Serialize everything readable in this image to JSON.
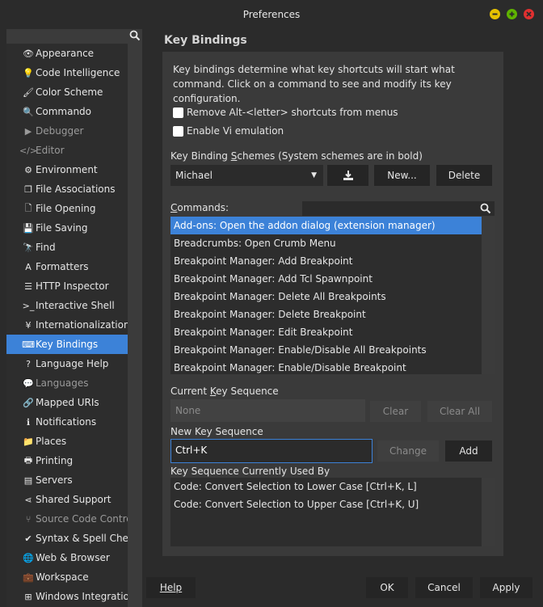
{
  "window": {
    "title": "Preferences"
  },
  "sidebar": {
    "items": [
      {
        "label": "Appearance",
        "icon": "eye-icon",
        "glyph": "👁",
        "dim": false
      },
      {
        "label": "Code Intelligence",
        "icon": "bulb-icon",
        "glyph": "💡",
        "dim": false
      },
      {
        "label": "Color Scheme",
        "icon": "brush-icon",
        "glyph": "🖌",
        "dim": false
      },
      {
        "label": "Commando",
        "icon": "search-icon",
        "glyph": "🔍",
        "dim": false
      },
      {
        "label": "Debugger",
        "icon": "play-icon",
        "glyph": "▶",
        "dim": true
      },
      {
        "label": "Editor",
        "icon": "code-icon",
        "glyph": "</>",
        "dim": true
      },
      {
        "label": "Environment",
        "icon": "gear-icon",
        "glyph": "⚙",
        "dim": false
      },
      {
        "label": "File Associations",
        "icon": "files-icon",
        "glyph": "❐",
        "dim": false
      },
      {
        "label": "File Opening",
        "icon": "file-icon",
        "glyph": "🗋",
        "dim": false
      },
      {
        "label": "File Saving",
        "icon": "floppy-icon",
        "glyph": "💾",
        "dim": false
      },
      {
        "label": "Find",
        "icon": "binoculars-icon",
        "glyph": "🔭",
        "dim": false
      },
      {
        "label": "Formatters",
        "icon": "font-icon",
        "glyph": "A",
        "dim": false
      },
      {
        "label": "HTTP Inspector",
        "icon": "list-icon",
        "glyph": "☰",
        "dim": false
      },
      {
        "label": "Interactive Shell",
        "icon": "terminal-icon",
        "glyph": ">_",
        "dim": false
      },
      {
        "label": "Internationalization",
        "icon": "yen-icon",
        "glyph": "¥",
        "dim": false
      },
      {
        "label": "Key Bindings",
        "icon": "keyboard-icon",
        "glyph": "⌨",
        "dim": false
      },
      {
        "label": "Language Help",
        "icon": "help-icon",
        "glyph": "?",
        "dim": false
      },
      {
        "label": "Languages",
        "icon": "speech-icon",
        "glyph": "💬",
        "dim": true
      },
      {
        "label": "Mapped URIs",
        "icon": "link-icon",
        "glyph": "🔗",
        "dim": false
      },
      {
        "label": "Notifications",
        "icon": "info-icon",
        "glyph": "ℹ",
        "dim": false
      },
      {
        "label": "Places",
        "icon": "folder-icon",
        "glyph": "📁",
        "dim": false
      },
      {
        "label": "Printing",
        "icon": "printer-icon",
        "glyph": "🖶",
        "dim": false
      },
      {
        "label": "Servers",
        "icon": "server-icon",
        "glyph": "▤",
        "dim": false
      },
      {
        "label": "Shared Support",
        "icon": "share-icon",
        "glyph": "⋖",
        "dim": false
      },
      {
        "label": "Source Code Control",
        "icon": "branch-icon",
        "glyph": "⑂",
        "dim": true
      },
      {
        "label": "Syntax & Spell Che...",
        "icon": "check-icon",
        "glyph": "✔",
        "dim": false
      },
      {
        "label": "Web & Browser",
        "icon": "globe-icon",
        "glyph": "🌐",
        "dim": false
      },
      {
        "label": "Workspace",
        "icon": "briefcase-icon",
        "glyph": "💼",
        "dim": false
      },
      {
        "label": "Windows Integration",
        "icon": "windows-icon",
        "glyph": "⊞",
        "dim": false
      }
    ],
    "selected": "Key Bindings"
  },
  "main": {
    "title": "Key Bindings",
    "description": "Key bindings determine what key shortcuts will start what command. Click on a command to see and modify its key configuration.",
    "remove_alt": "Remove Alt-<letter> shortcuts from menus",
    "vi_emulation": "Enable Vi emulation",
    "schemes_label_pre": "Key Binding ",
    "schemes_label_u": "S",
    "schemes_label_post": "chemes (System schemes are in bold)",
    "scheme_value": "Michael",
    "btn_new": "New...",
    "btn_delete": "Delete",
    "commands_label_u": "C",
    "commands_label_post": "ommands:",
    "commands": [
      "Add-ons: Open the addon dialog (extension manager)",
      "Breadcrumbs: Open Crumb Menu",
      "Breakpoint Manager: Add Breakpoint",
      "Breakpoint Manager: Add Tcl Spawnpoint",
      "Breakpoint Manager: Delete All Breakpoints",
      "Breakpoint Manager: Delete Breakpoint",
      "Breakpoint Manager: Edit Breakpoint",
      "Breakpoint Manager: Enable/Disable All Breakpoints",
      "Breakpoint Manager: Enable/Disable Breakpoint"
    ],
    "current_key_label_pre": "Current ",
    "current_key_label_u": "K",
    "current_key_label_post": "ey Sequence",
    "current_key_value": "None",
    "btn_clear": "Clear",
    "btn_clear_all": "Clear All",
    "new_key_label": "New Key Sequence",
    "new_key_value": "Ctrl+K",
    "btn_change": "Change",
    "btn_add": "Add",
    "used_by_label": "Key Sequence Currently Used By",
    "used_by": [
      "Code: Convert Selection to Lower Case [Ctrl+K, L]",
      "Code: Convert Selection to Upper Case [Ctrl+K, U]"
    ]
  },
  "footer": {
    "help": "Help",
    "ok": "OK",
    "cancel": "Cancel",
    "apply": "Apply"
  },
  "colors": {
    "accent": "#3c82d8",
    "minimize": "#e6c100",
    "maximize": "#5fb300",
    "close": "#e03030"
  }
}
